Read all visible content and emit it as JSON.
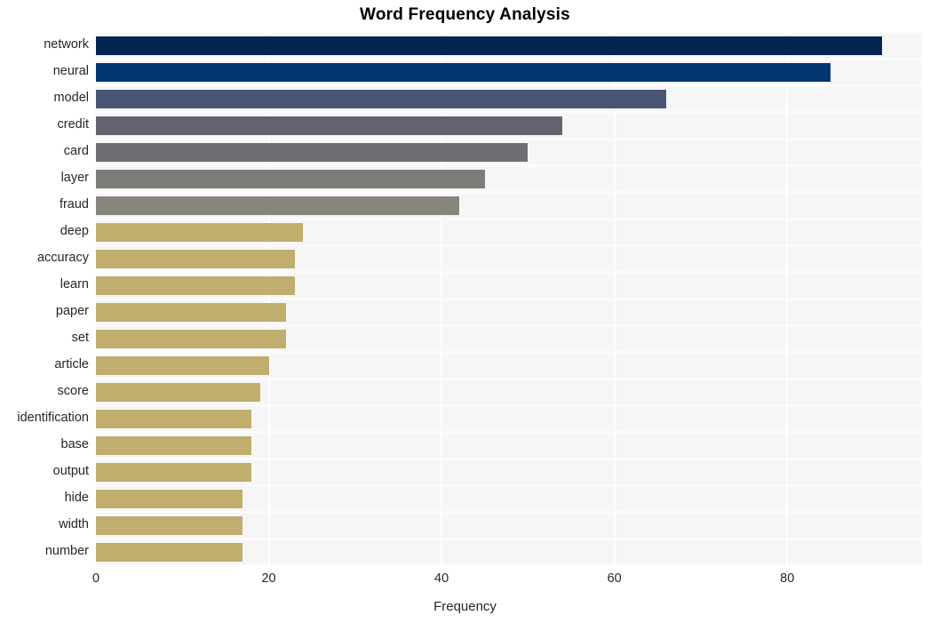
{
  "chart_data": {
    "type": "bar",
    "orientation": "horizontal",
    "title": "Word Frequency Analysis",
    "xlabel": "Frequency",
    "ylabel": "",
    "categories": [
      "network",
      "neural",
      "model",
      "credit",
      "card",
      "layer",
      "fraud",
      "deep",
      "accuracy",
      "learn",
      "paper",
      "set",
      "article",
      "score",
      "identification",
      "base",
      "output",
      "hide",
      "width",
      "number"
    ],
    "values": [
      91,
      85,
      66,
      54,
      50,
      45,
      42,
      24,
      23,
      23,
      22,
      22,
      20,
      19,
      18,
      18,
      18,
      17,
      17,
      17
    ],
    "colors": [
      "#032550",
      "#033670",
      "#4a5574",
      "#63646f",
      "#6e6e73",
      "#7c7c79",
      "#87857c",
      "#bfae6e",
      "#bfae6e",
      "#bfae6e",
      "#bfae6e",
      "#bfae6e",
      "#bfae6e",
      "#bfae6e",
      "#bfae6e",
      "#bfae6e",
      "#bfae6e",
      "#bfae6e",
      "#bfae6e",
      "#bfae6e"
    ],
    "xticks": [
      0,
      20,
      40,
      60,
      80
    ],
    "xtick_labels": [
      "0",
      "20",
      "40",
      "60",
      "80"
    ],
    "xlim": [
      0,
      95.6
    ],
    "grid": true,
    "legend": false,
    "plot_background": "#f6f6f7",
    "gridline_color": "#ffffff",
    "figure_background": "#ffffff"
  }
}
